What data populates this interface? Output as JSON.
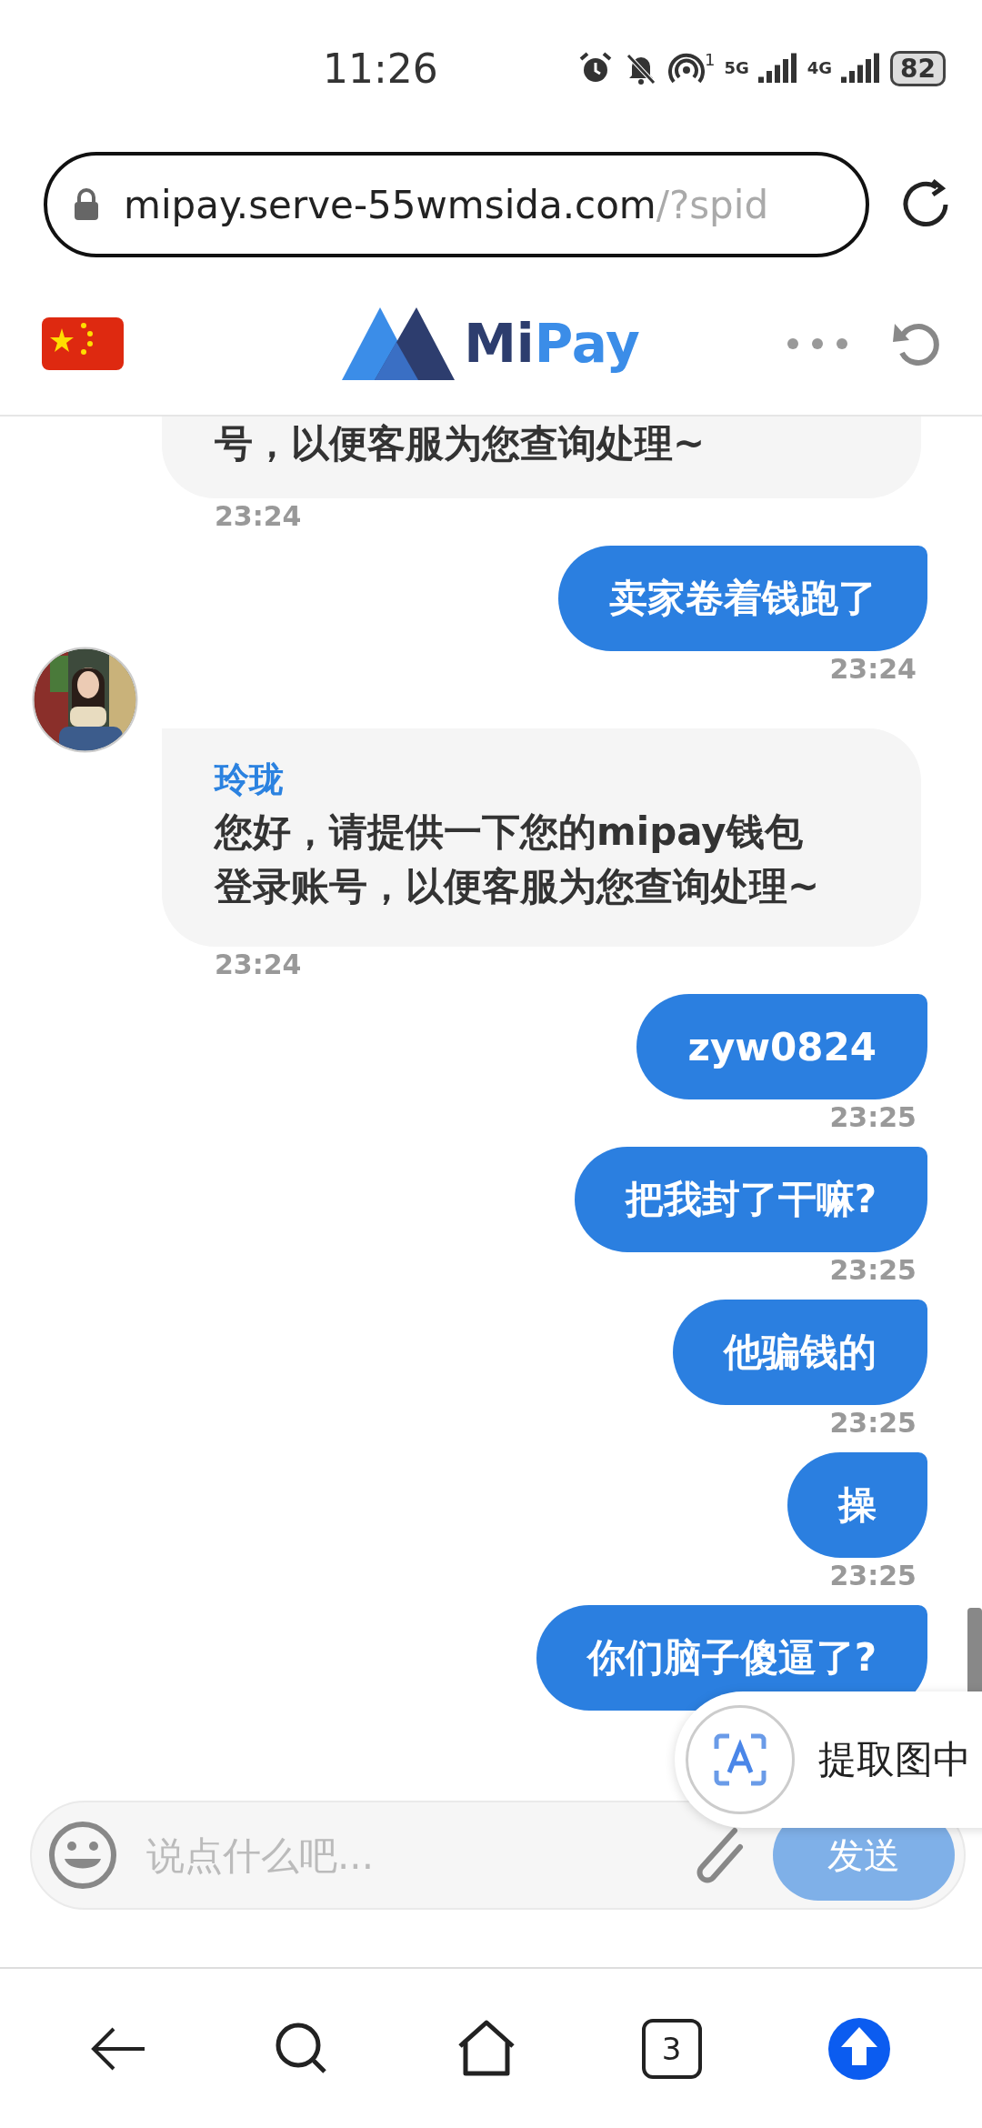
{
  "status_bar": {
    "time": "11:26",
    "hotspot_count": "1",
    "network_1": "5G",
    "network_2": "4G",
    "battery": "82"
  },
  "address_bar": {
    "host": "mipay.serve-55wmsida.com",
    "path": "/?spid"
  },
  "header": {
    "logo_dark": "Mi",
    "logo_light": "Pay"
  },
  "messages": [
    {
      "kind": "incoming",
      "text": "号，以便客服为您查询处理~",
      "time": "23:24"
    },
    {
      "kind": "outgoing",
      "text": "卖家卷着钱跑了",
      "time": "23:24"
    },
    {
      "kind": "incoming",
      "sender": "玲珑",
      "text": "您好，请提供一下您的mipay钱包登录账号，以便客服为您查询处理~",
      "time": "23:24"
    },
    {
      "kind": "outgoing",
      "text": "zyw0824",
      "time": "23:25"
    },
    {
      "kind": "outgoing",
      "text": "把我封了干嘛?",
      "time": "23:25"
    },
    {
      "kind": "outgoing",
      "text": "他骗钱的",
      "time": "23:25"
    },
    {
      "kind": "outgoing",
      "text": "操",
      "time": "23:25"
    },
    {
      "kind": "outgoing",
      "text": "你们脑子傻逼了?"
    }
  ],
  "text_extract_popup": {
    "label": "提取图中"
  },
  "composer": {
    "placeholder": "说点什么吧...",
    "send": "发送"
  },
  "bottom_nav": {
    "tab_count": "3"
  }
}
